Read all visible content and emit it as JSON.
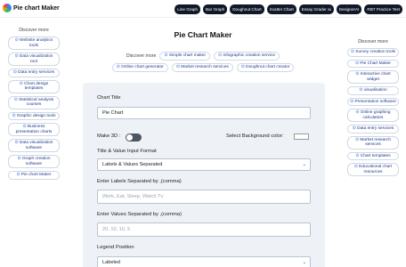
{
  "header": {
    "brand": "Pie chart Maker",
    "nav": [
      "Line Graph",
      "Bar Graph",
      "Doughnut Chart",
      "Scatter Chart",
      "Essay Grader ai",
      "DesignerAI",
      "RBT Practice Test"
    ]
  },
  "left": {
    "title": "Discover more",
    "items": [
      "Website analytics tools",
      "Data visualization tool",
      "Data entry services",
      "Chart design templates",
      "Statistical analysis courses",
      "Graphic design tools",
      "Business presentation charts",
      "Data visualization software",
      "Graph creation software",
      "Pie chart Maker"
    ]
  },
  "right": {
    "title": "Discover more",
    "items": [
      "Survey creation tools",
      "Pie Chart Maker",
      "Interactive chart widget",
      "visualisation",
      "Presentation software",
      "Online graphing calculators",
      "Data entry services",
      "Market research services",
      "Chart templates",
      "Educational chart resources"
    ]
  },
  "main": {
    "title": "Pie Chart Maker",
    "discover_label": "Discover more",
    "chips_row1": [
      "Simple chart maker",
      "Infographic creation service"
    ],
    "chips_row2": [
      "Online chart generator",
      "Market research services",
      "Doughnut chart creator"
    ]
  },
  "form": {
    "chart_title_label": "Chart Title",
    "chart_title_value": "Pie Chart",
    "make3d_label": "Make 3D :",
    "bg_color_label": "Select Background color:",
    "input_format_label": "Title & Value Input Format",
    "input_format_value": "Labels & Values Separated",
    "labels_label": "Enter Labels Separated by ,(comma)",
    "labels_placeholder": "Work, Eat, Sleep, Watch Tv",
    "values_label": "Enter Values Separated by ,(comma)",
    "values_placeholder": "20, 10, 10, 5",
    "legend_label": "Legend Position",
    "legend_value": "Labeled"
  },
  "icons": {
    "chip": "circle-arrow-icon",
    "brand": "pie-chart-icon",
    "select": "chevron-down-icon"
  }
}
